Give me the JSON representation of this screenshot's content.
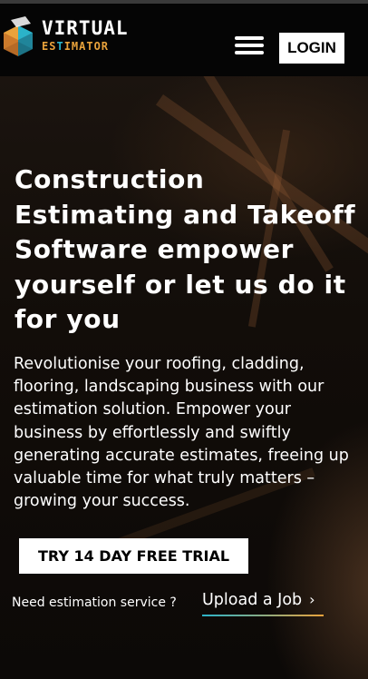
{
  "header": {
    "logo": {
      "line1": "VIRTUAL",
      "line2_prefix": "ES",
      "line2_accent": "T",
      "line2_suffix": "IMATOR"
    },
    "menu_icon": "hamburger-menu-icon",
    "login_label": "LOGIN"
  },
  "hero": {
    "title": "Construction Estimating and Takeoff Software empower yourself or let us do it for you",
    "description": "Revolutionise your roofing, cladding, flooring, landscaping business with our estimation solution. Empower your business by effortlessly and swiftly generating accurate estimates, freeing up valuable time for what truly matters – growing your success.",
    "trial_button_label": "TRY 14 DAY FREE TRIAL",
    "service_prompt": "Need estimation service ?",
    "upload_link_label": "Upload a Job",
    "upload_link_arrow": "›"
  },
  "colors": {
    "brand_orange": "#e9a23b",
    "brand_teal": "#2bb3c9",
    "header_bg": "#050505",
    "button_bg": "#ffffff"
  }
}
